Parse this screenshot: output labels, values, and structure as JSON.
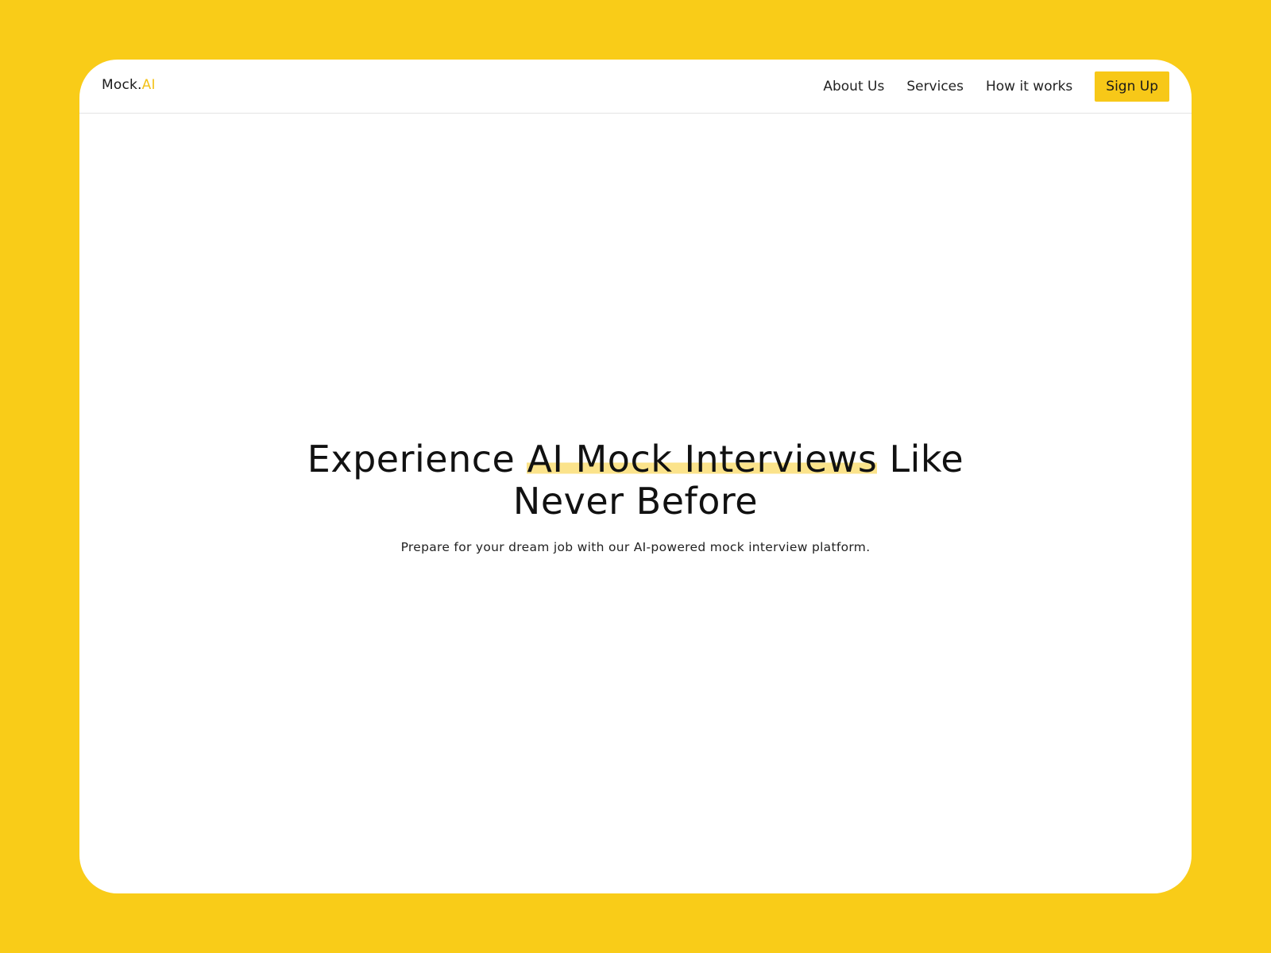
{
  "brand": {
    "name_prefix": "Mock.",
    "name_accent": "AI"
  },
  "nav": {
    "links": [
      "About Us",
      "Services",
      "How it works"
    ],
    "signup_label": "Sign Up"
  },
  "hero": {
    "headline_before": "Experience ",
    "headline_highlight": "AI Mock Interviews",
    "headline_after": " Like Never Before",
    "subtitle": "Prepare for your dream job with our AI-powered mock interview platform."
  },
  "colors": {
    "background": "#F9CC18",
    "accent": "#F7C818",
    "highlight": "#FBE38B"
  }
}
